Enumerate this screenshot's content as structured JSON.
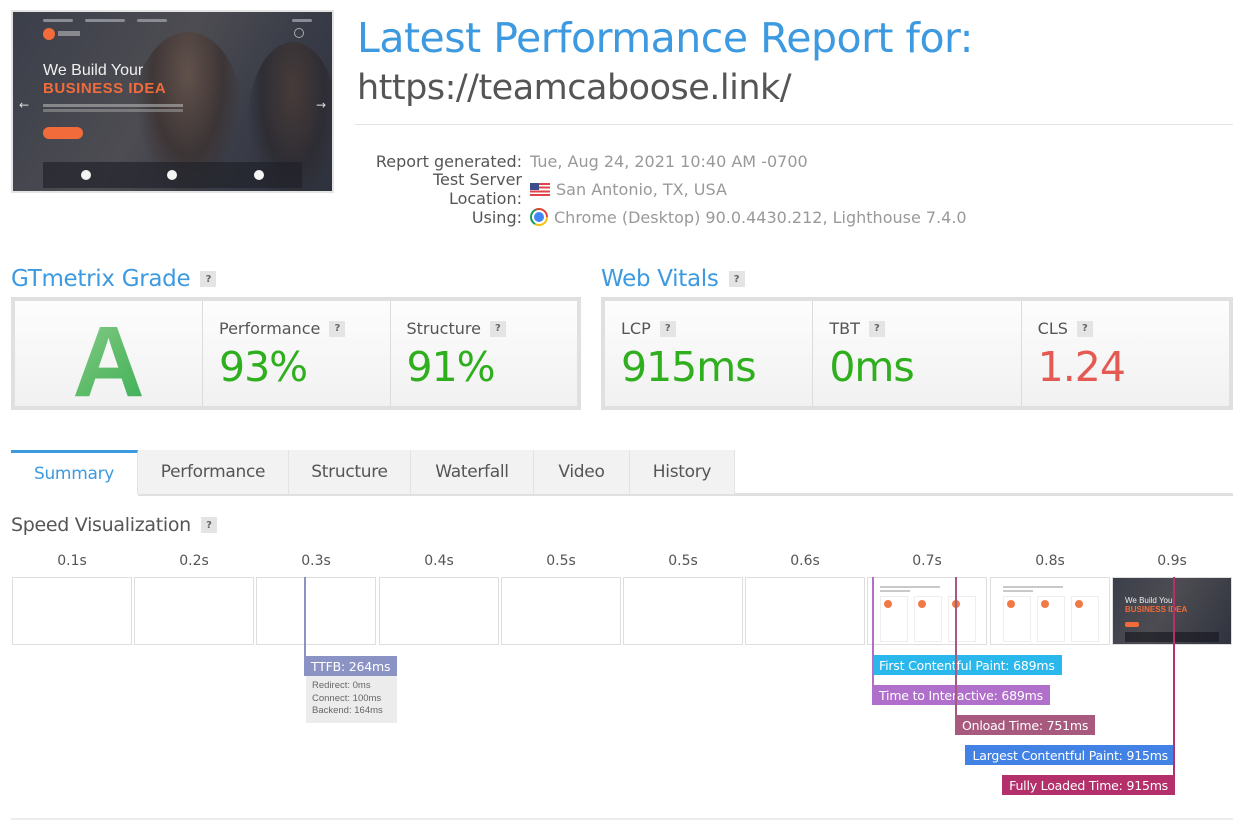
{
  "report": {
    "title": "Latest Performance Report for:",
    "url": "https://teamcaboose.link/",
    "thumbnail": {
      "headline_line1": "We Build Your",
      "headline_line2": "BUSINESS IDEA"
    },
    "meta": [
      {
        "label": "Report generated:",
        "value": "Tue, Aug 24, 2021 10:40 AM -0700",
        "icon": ""
      },
      {
        "label": "Test Server Location:",
        "value": "San Antonio, TX, USA",
        "icon": "us-flag-icon"
      },
      {
        "label": "Using:",
        "value": "Chrome (Desktop) 90.0.4430.212, Lighthouse 7.4.0",
        "icon": "chrome-icon"
      }
    ]
  },
  "grade": {
    "heading": "GTmetrix Grade",
    "help": "?",
    "letter": "A",
    "metrics": [
      {
        "label": "Performance",
        "value": "93%",
        "status": "good"
      },
      {
        "label": "Structure",
        "value": "91%",
        "status": "good"
      }
    ]
  },
  "web_vitals": {
    "heading": "Web Vitals",
    "help": "?",
    "metrics": [
      {
        "label": "LCP",
        "value": "915ms",
        "status": "good"
      },
      {
        "label": "TBT",
        "value": "0ms",
        "status": "good"
      },
      {
        "label": "CLS",
        "value": "1.24",
        "status": "bad"
      }
    ]
  },
  "tabs": [
    {
      "label": "Summary",
      "active": true
    },
    {
      "label": "Performance",
      "active": false
    },
    {
      "label": "Structure",
      "active": false
    },
    {
      "label": "Waterfall",
      "active": false
    },
    {
      "label": "Video",
      "active": false
    },
    {
      "label": "History",
      "active": false
    }
  ],
  "speed_visualization": {
    "heading": "Speed Visualization",
    "help": "?",
    "frames": [
      {
        "label": "0.1s",
        "state": "blank"
      },
      {
        "label": "0.2s",
        "state": "blank"
      },
      {
        "label": "0.3s",
        "state": "blank"
      },
      {
        "label": "0.4s",
        "state": "blank"
      },
      {
        "label": "0.5s",
        "state": "blank"
      },
      {
        "label": "0.5s",
        "state": "blank"
      },
      {
        "label": "0.6s",
        "state": "blank"
      },
      {
        "label": "0.7s",
        "state": "partial"
      },
      {
        "label": "0.8s",
        "state": "partial"
      },
      {
        "label": "0.9s",
        "state": "complete"
      }
    ],
    "ttfb": {
      "label": "TTFB: 264ms",
      "ms": 264,
      "color": "#8b93c4",
      "details": [
        "Redirect: 0ms",
        "Connect: 100ms",
        "Backend: 164ms"
      ]
    },
    "markers": [
      {
        "label": "First Contentful Paint: 689ms",
        "ms": 689,
        "color": "#2ab7ec"
      },
      {
        "label": "Time to Interactive: 689ms",
        "ms": 689,
        "color": "#b06fcb"
      },
      {
        "label": "Onload Time: 751ms",
        "ms": 751,
        "color": "#a85a7e"
      },
      {
        "label": "Largest Contentful Paint: 915ms",
        "ms": 915,
        "color": "#4282e4"
      },
      {
        "label": "Fully Loaded Time: 915ms",
        "ms": 915,
        "color": "#b3306b"
      }
    ]
  },
  "colors": {
    "accent": "#3d9ae0",
    "good": "#2fae1e",
    "bad": "#e45a52"
  }
}
